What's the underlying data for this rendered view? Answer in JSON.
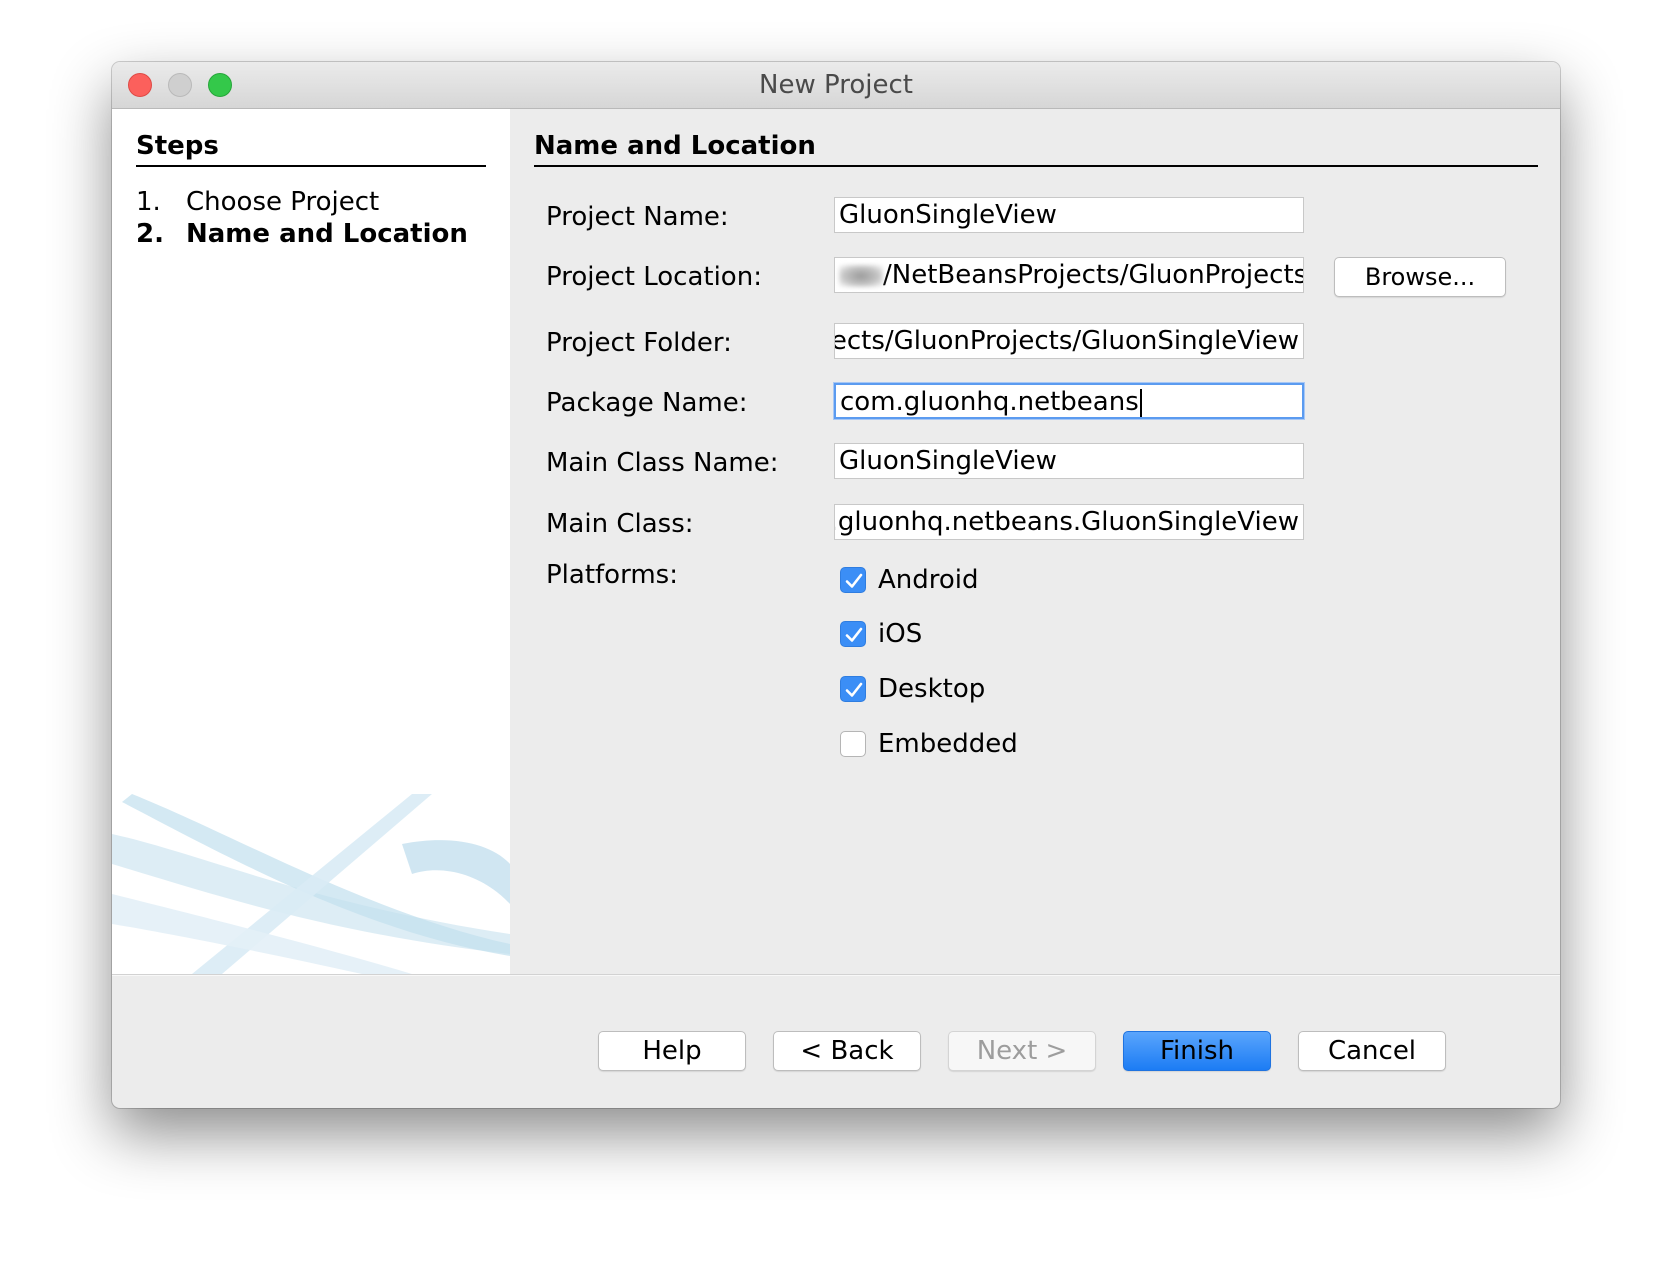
{
  "window": {
    "title": "New Project"
  },
  "steps": {
    "title": "Steps",
    "items": [
      {
        "num": "1.",
        "label": "Choose Project"
      },
      {
        "num": "2.",
        "label": "Name and Location"
      }
    ]
  },
  "form": {
    "title": "Name and Location",
    "project_name": {
      "label": "Project Name:",
      "value": "GluonSingleView"
    },
    "project_location": {
      "label": "Project Location:",
      "value": "/NetBeansProjects/GluonProjects"
    },
    "project_folder": {
      "label": "Project Folder:",
      "value": "ects/GluonProjects/GluonSingleView"
    },
    "package_name": {
      "label": "Package Name:",
      "value": "com.gluonhq.netbeans"
    },
    "main_class_name": {
      "label": "Main Class Name:",
      "value": "GluonSingleView"
    },
    "main_class": {
      "label": "Main Class:",
      "value": "n.gluonhq.netbeans.GluonSingleView"
    },
    "browse_label": "Browse...",
    "platforms_label": "Platforms:",
    "platforms": [
      {
        "label": "Android",
        "checked": true
      },
      {
        "label": "iOS",
        "checked": true
      },
      {
        "label": "Desktop",
        "checked": true
      },
      {
        "label": "Embedded",
        "checked": false
      }
    ]
  },
  "buttons": {
    "help": "Help",
    "back": "< Back",
    "next": "Next >",
    "finish": "Finish",
    "cancel": "Cancel"
  },
  "colors": {
    "accent": "#3b8ef6",
    "focus_ring": "#5b9bf0",
    "close": "#fc605c",
    "zoom": "#34c84a"
  }
}
